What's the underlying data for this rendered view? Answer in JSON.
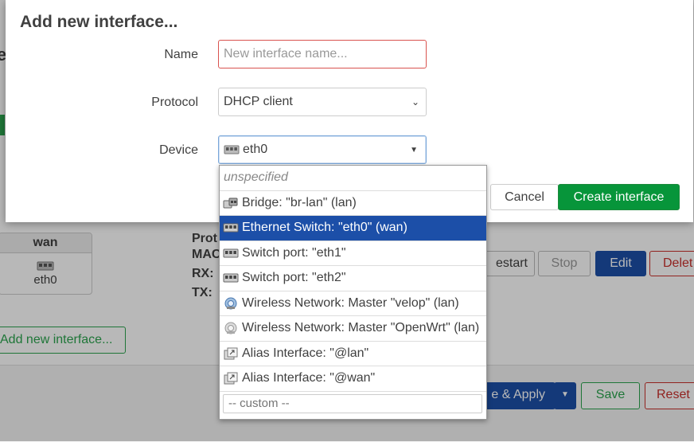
{
  "background": {
    "title_fragment": "e",
    "interface_card": {
      "name": "wan",
      "device": "eth0"
    },
    "info_labels": [
      "Prot",
      "MAC",
      "RX:",
      "TX:"
    ],
    "buttons": {
      "restart": "estart",
      "stop": "Stop",
      "edit": "Edit",
      "delete": "Delet"
    },
    "add_interface_label": "Add new interface...",
    "footer_buttons": {
      "save_apply": "e & Apply",
      "save": "Save",
      "reset": "Reset"
    }
  },
  "modal": {
    "title": "Add new interface...",
    "name_label": "Name",
    "name_placeholder": "New interface name...",
    "protocol_label": "Protocol",
    "protocol_value": "DHCP client",
    "device_label": "Device",
    "device_value": "eth0",
    "cancel_label": "Cancel",
    "create_label": "Create interface"
  },
  "dropdown": {
    "items": [
      {
        "label": "unspecified",
        "icon": "none",
        "state": "placeholder"
      },
      {
        "label": "Bridge: \"br-lan\" (lan)",
        "icon": "bridge-icon",
        "state": ""
      },
      {
        "label": "Ethernet Switch: \"eth0\" (wan)",
        "icon": "ethernet-switch-icon",
        "state": "selected"
      },
      {
        "label": "Switch port: \"eth1\"",
        "icon": "switch-port-icon",
        "state": ""
      },
      {
        "label": "Switch port: \"eth2\"",
        "icon": "switch-port-icon",
        "state": ""
      },
      {
        "label": "Wireless Network: Master \"velop\" (lan)",
        "icon": "wifi-icon",
        "state": ""
      },
      {
        "label": "Wireless Network: Master \"OpenWrt\" (lan)",
        "icon": "wifi-disabled-icon",
        "state": ""
      },
      {
        "label": "Alias Interface: \"@lan\"",
        "icon": "alias-icon",
        "state": ""
      },
      {
        "label": "Alias Interface: \"@wan\"",
        "icon": "alias-icon",
        "state": ""
      }
    ],
    "custom_placeholder": "-- custom --"
  },
  "colors": {
    "primary_green": "#07953a",
    "selected_blue": "#1c4fa8",
    "edit_blue": "#1c4fa8",
    "delete_red": "#c9302c",
    "error_border": "#d9534f"
  }
}
